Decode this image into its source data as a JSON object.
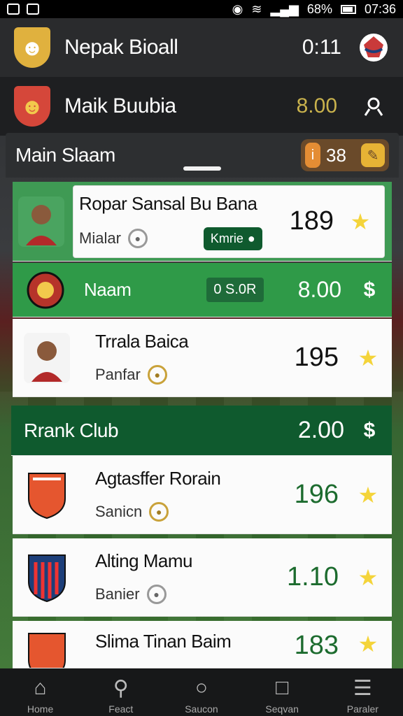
{
  "statusbar": {
    "battery": "68%",
    "time": "07:36"
  },
  "header1": {
    "title": "Nepak Bioall",
    "value": "0:11"
  },
  "header2": {
    "title": "Maik Buubia",
    "value": "8.00"
  },
  "panel": {
    "title": "Main Slaam",
    "coin_value": "38"
  },
  "rows": [
    {
      "name": "Ropar Sansal Bu Bana",
      "sub": "Mialar",
      "tag": "Kmrie",
      "score": "189"
    },
    {
      "name": "Naam",
      "tag": "0 S.0R",
      "score": "8.00"
    },
    {
      "name": "Trrala Baica",
      "sub": "Panfar",
      "score": "195"
    },
    {
      "name": "Rrank Club",
      "score": "2.00"
    },
    {
      "name": "Agtasffer Rorain",
      "sub": "Sanicn",
      "score": "196"
    },
    {
      "name": "Alting Mamu",
      "sub": "Banier",
      "score": "1.10"
    },
    {
      "name": "Slima Tinan Baim",
      "score": "183"
    }
  ],
  "nav": [
    {
      "label": "Home",
      "icon": "home-icon"
    },
    {
      "label": "Feact",
      "icon": "search-icon"
    },
    {
      "label": "Saucon",
      "icon": "circle-icon"
    },
    {
      "label": "Seqvan",
      "icon": "square-icon"
    },
    {
      "label": "Paraler",
      "icon": "menu-icon"
    }
  ],
  "colors": {
    "accent_green": "#2f9a48",
    "dark_green": "#0f5a2e",
    "gold": "#f4d43a",
    "coin": "#e7b335"
  }
}
